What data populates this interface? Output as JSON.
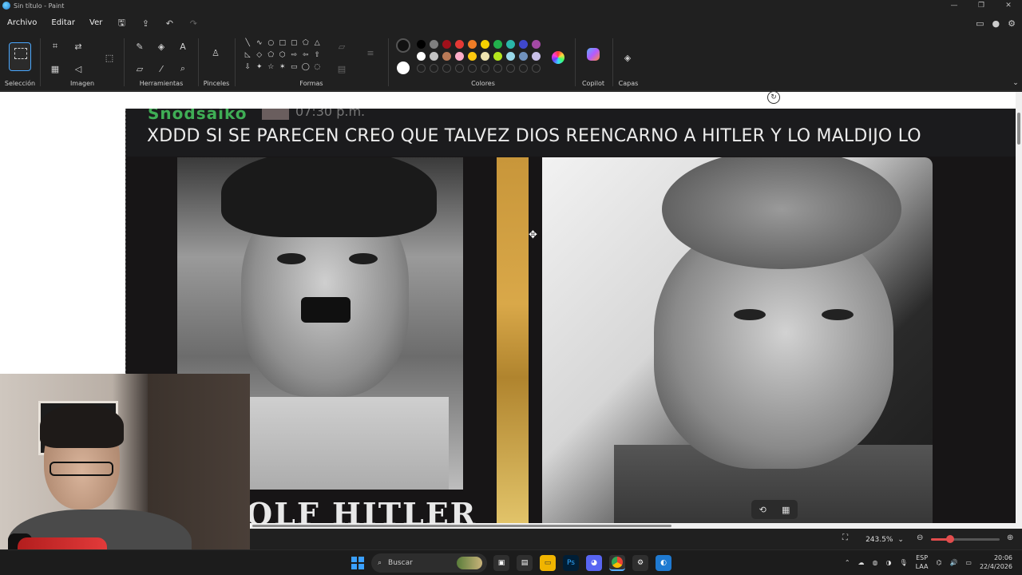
{
  "titlebar": {
    "title": "Sin título - Paint",
    "min": "—",
    "max": "❐",
    "close": "✕"
  },
  "menu": {
    "file": "Archivo",
    "edit": "Editar",
    "view": "Ver"
  },
  "ribbon": {
    "groups": {
      "selection": "Selección",
      "image": "Imagen",
      "tools": "Herramientas",
      "brushes": "Pinceles",
      "shapes": "Formas",
      "colors": "Colores",
      "copilot": "Copilot",
      "layers": "Capas"
    },
    "palette_row1": [
      "#000000",
      "#7f7f7f",
      "#a0101a",
      "#e53935",
      "#ef7c26",
      "#f5d000",
      "#22b14c",
      "#2ab7a9",
      "#3f48cc",
      "#a349a4"
    ],
    "palette_row2": [
      "#ffffff",
      "#c3c3c3",
      "#b97a57",
      "#ffaec9",
      "#ffc90e",
      "#efe4b0",
      "#b5e61d",
      "#99d9ea",
      "#7092be",
      "#c8bfe7"
    ],
    "primary_color": "#111111",
    "secondary_color": "#ffffff"
  },
  "canvas": {
    "cutoff_name": "Snodsaiko",
    "cutoff_time": "07:30 p.m.",
    "caption": "XDDD SI SE PARECEN CREO QUE TALVEZ DIOS REENCARNO A HITLER Y LO MALDIJO LO",
    "bottom_text": "OLF HITLER"
  },
  "status": {
    "zoom": "243.5%"
  },
  "taskbar": {
    "search_placeholder": "Buscar",
    "lang_top": "ESP",
    "lang_bottom": "LAA",
    "time": "20:06",
    "date": "22/4/2026"
  }
}
